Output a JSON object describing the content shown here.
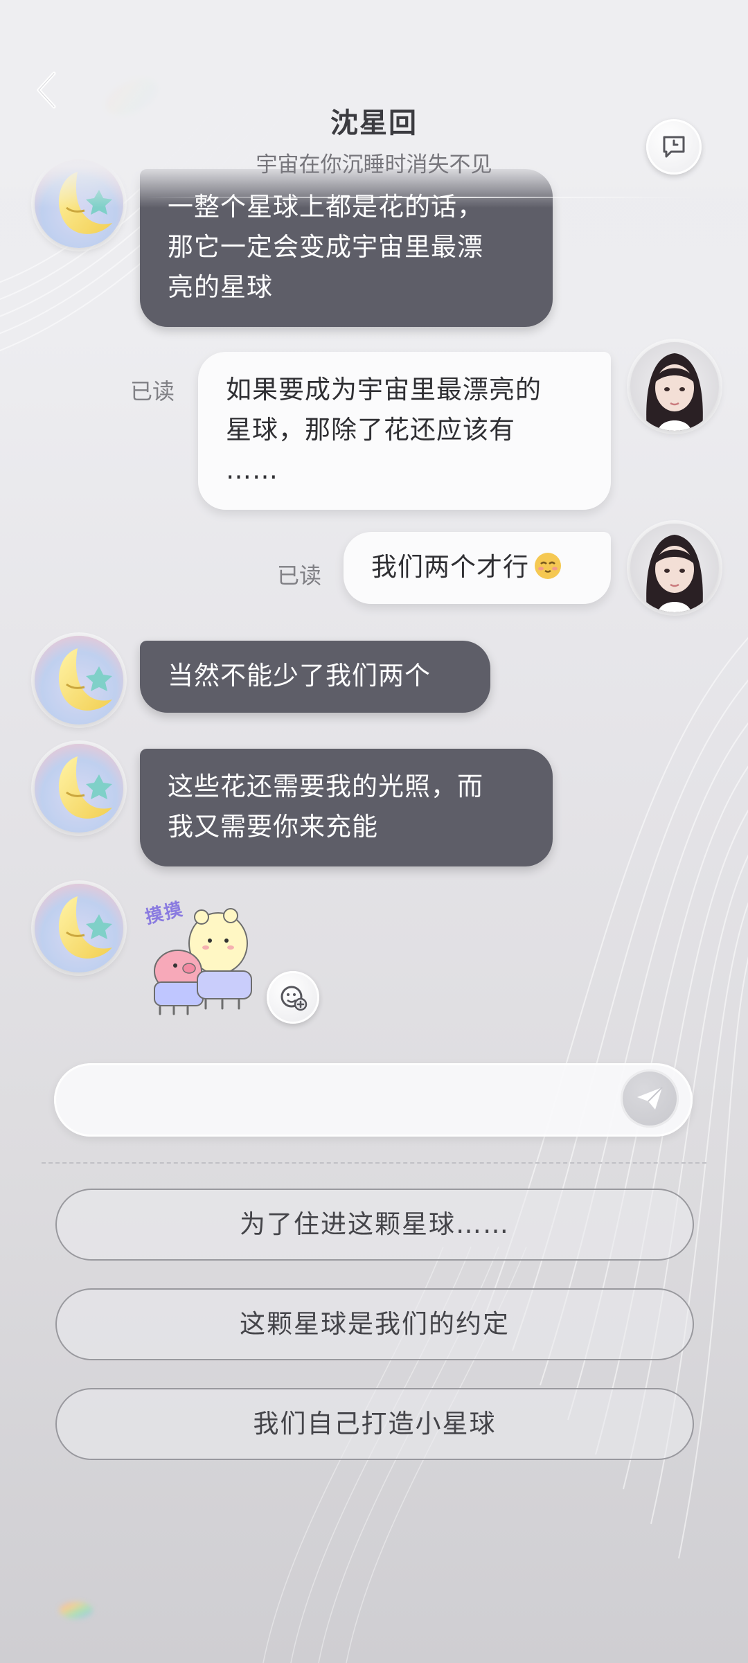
{
  "header": {
    "title": "沈星回",
    "subtitle": "宇宙在你沉睡时消失不见",
    "back_icon": "chevron-left-icon",
    "history_icon": "chat-history-icon"
  },
  "messages": [
    {
      "sender": "ai",
      "text_lines": [
        "一整个星球上都是花的话，",
        "那它一定会变成宇宙里最漂",
        "亮的星球"
      ]
    },
    {
      "sender": "me",
      "status": "已读",
      "text_lines": [
        "如果要成为宇宙里最漂亮的",
        "星球，那除了花还应该有",
        "……"
      ]
    },
    {
      "sender": "me",
      "status": "已读",
      "text_lines": [
        "我们两个才行"
      ],
      "emoji": "blushing-face-emoji"
    },
    {
      "sender": "ai",
      "text_lines": [
        "当然不能少了我们两个"
      ]
    },
    {
      "sender": "ai",
      "text_lines": [
        "这些花还需要我的光照，而",
        "我又需要你来充能"
      ]
    },
    {
      "sender": "ai",
      "type": "sticker",
      "sticker_text": "摸摸",
      "sticker_icon": "pet-pet-sticker"
    }
  ],
  "composer": {
    "placeholder": "",
    "value": "",
    "send_icon": "send-icon",
    "sticker_add_icon": "add-sticker-icon"
  },
  "suggestions": [
    {
      "label": "为了住进这颗星球……"
    },
    {
      "label": "这颗星球是我们的约定"
    },
    {
      "label": "我们自己打造小星球"
    }
  ],
  "colors": {
    "ai_bubble": "#5e5e68",
    "me_bubble": "#fbfbfc",
    "background": "#e6e5e9"
  }
}
